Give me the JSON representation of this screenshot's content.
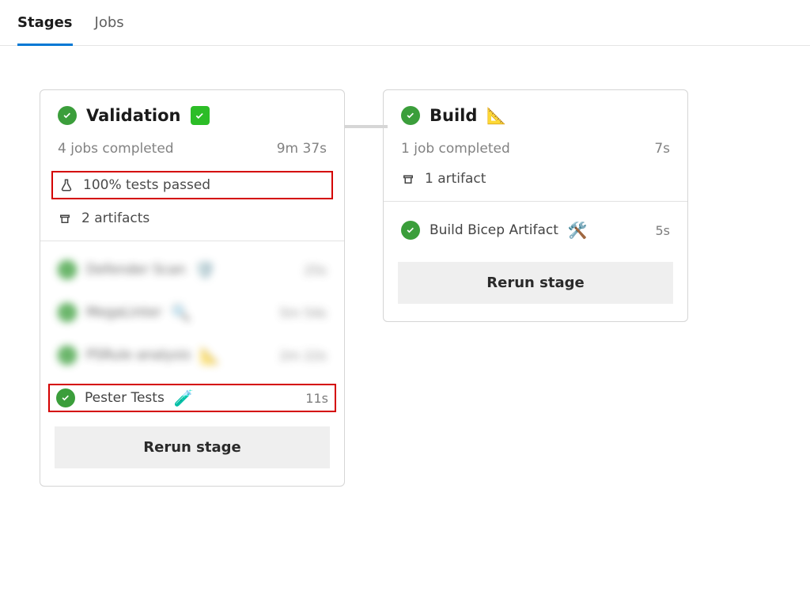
{
  "tabs": {
    "stages": "Stages",
    "jobs": "Jobs",
    "active": "stages"
  },
  "stages": [
    {
      "key": "validation",
      "title": "Validation",
      "title_emoji": "✅",
      "status": "success",
      "jobs_summary": "4 jobs completed",
      "duration": "9m 37s",
      "tests_passed": "100% tests passed",
      "artifacts_label": "2 artifacts",
      "jobs": [
        {
          "name": "Defender Scan",
          "emoji": "🛡️",
          "duration": "25s",
          "highlight": false,
          "blurred": true
        },
        {
          "name": "MegaLinter",
          "emoji": "🔍",
          "duration": "5m 54s",
          "highlight": false,
          "blurred": true
        },
        {
          "name": "PSRule analysis",
          "emoji": "📐",
          "duration": "2m 22s",
          "highlight": false,
          "blurred": true
        },
        {
          "name": "Pester Tests",
          "emoji": "🧪",
          "duration": "11s",
          "highlight": true,
          "blurred": false
        }
      ],
      "rerun_label": "Rerun stage"
    },
    {
      "key": "build",
      "title": "Build",
      "title_emoji": "📐",
      "status": "success",
      "jobs_summary": "1 job completed",
      "duration": "7s",
      "artifacts_label": "1 artifact",
      "jobs": [
        {
          "name": "Build Bicep Artifact",
          "emoji": "🛠️",
          "duration": "5s",
          "highlight": false,
          "blurred": false
        }
      ],
      "rerun_label": "Rerun stage"
    }
  ]
}
